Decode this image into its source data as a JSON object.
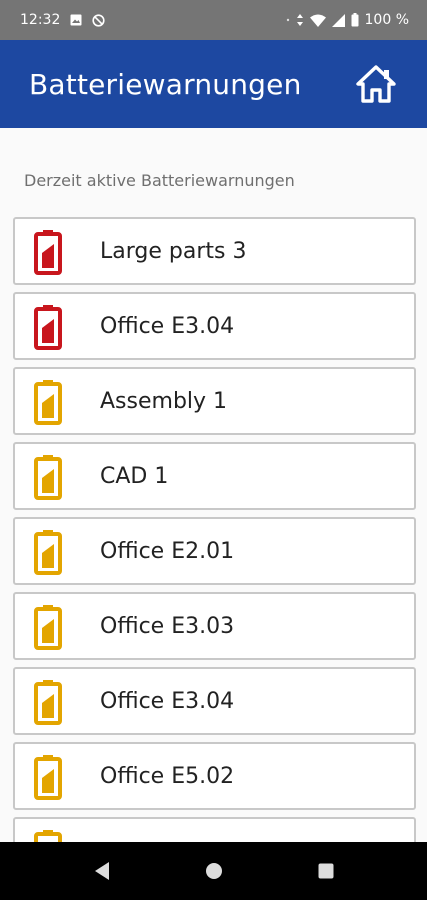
{
  "status_bar": {
    "time": "12:32",
    "battery": "100 %"
  },
  "app_bar": {
    "title": "Batteriewarnungen",
    "home_icon": "home-icon"
  },
  "section_label": "Derzeit aktive Batteriewarnungen",
  "colors": {
    "critical": "#c8161d",
    "warning": "#e3a500",
    "primary": "#1d48a1"
  },
  "warnings": [
    {
      "label": "Large parts 3",
      "level": "critical"
    },
    {
      "label": "Office E3.04",
      "level": "critical"
    },
    {
      "label": "Assembly 1",
      "level": "warning"
    },
    {
      "label": "CAD 1",
      "level": "warning"
    },
    {
      "label": "Office E2.01",
      "level": "warning"
    },
    {
      "label": "Office E3.03",
      "level": "warning"
    },
    {
      "label": "Office E3.04",
      "level": "warning"
    },
    {
      "label": "Office E5.02",
      "level": "warning"
    },
    {
      "label": "",
      "level": "warning"
    }
  ],
  "nav": {
    "back": "back-icon",
    "home": "home-circle-icon",
    "recents": "recents-icon"
  }
}
